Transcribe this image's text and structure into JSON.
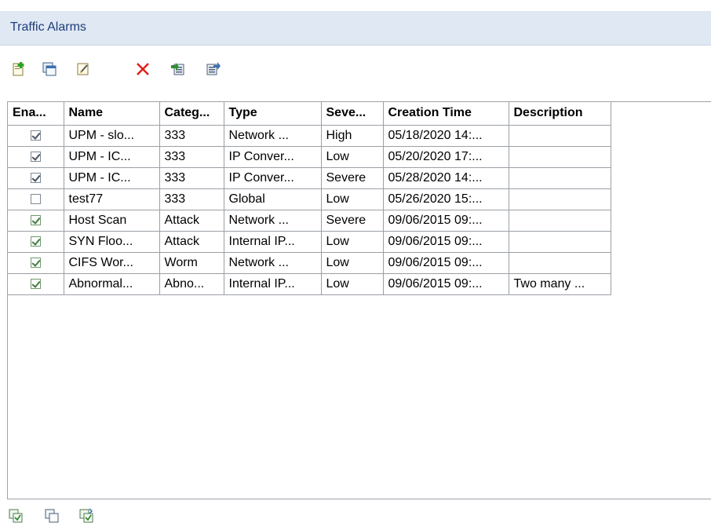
{
  "panel": {
    "title": "Traffic Alarms"
  },
  "toolbar": {
    "buttons": [
      {
        "icon": "add-alarm-icon"
      },
      {
        "icon": "copy-window-icon"
      },
      {
        "icon": "edit-icon"
      },
      {
        "icon": "delete-icon"
      },
      {
        "icon": "import-icon"
      },
      {
        "icon": "export-icon"
      }
    ]
  },
  "table": {
    "columns": [
      "Ena...",
      "Name",
      "Categ...",
      "Type",
      "Seve...",
      "Creation Time",
      "Description"
    ],
    "rows": [
      {
        "enabled": true,
        "style": "gray",
        "name": "UPM - slo...",
        "category": "333",
        "type": "Network ...",
        "severity": "High",
        "created": "05/18/2020 14:...",
        "description": ""
      },
      {
        "enabled": true,
        "style": "gray",
        "name": "UPM - IC...",
        "category": "333",
        "type": "IP Conver...",
        "severity": "Low",
        "created": "05/20/2020 17:...",
        "description": ""
      },
      {
        "enabled": true,
        "style": "gray",
        "name": "UPM - IC...",
        "category": "333",
        "type": "IP Conver...",
        "severity": "Severe",
        "created": "05/28/2020 14:...",
        "description": ""
      },
      {
        "enabled": false,
        "style": "gray",
        "name": "test77",
        "category": "333",
        "type": "Global",
        "severity": "Low",
        "created": "05/26/2020 15:...",
        "description": ""
      },
      {
        "enabled": true,
        "style": "green",
        "name": "Host Scan",
        "category": "Attack",
        "type": "Network ...",
        "severity": "Severe",
        "created": "09/06/2015 09:...",
        "description": ""
      },
      {
        "enabled": true,
        "style": "green",
        "name": "SYN Floo...",
        "category": "Attack",
        "type": "Internal IP...",
        "severity": "Low",
        "created": "09/06/2015 09:...",
        "description": ""
      },
      {
        "enabled": true,
        "style": "green",
        "name": "CIFS Wor...",
        "category": "Worm",
        "type": "Network ...",
        "severity": "Low",
        "created": "09/06/2015 09:...",
        "description": ""
      },
      {
        "enabled": true,
        "style": "green",
        "name": "Abnormal...",
        "category": "Abno...",
        "type": "Internal IP...",
        "severity": "Low",
        "created": "09/06/2015 09:...",
        "description": "Two many ..."
      }
    ]
  },
  "bottom_toolbar": {
    "buttons": [
      {
        "icon": "select-all-icon"
      },
      {
        "icon": "deselect-icon"
      },
      {
        "icon": "invert-selection-icon"
      }
    ]
  },
  "colors": {
    "title_bg": "#dfe8f3",
    "title_text": "#1f3d7a",
    "grid": "#9aa0a6"
  }
}
